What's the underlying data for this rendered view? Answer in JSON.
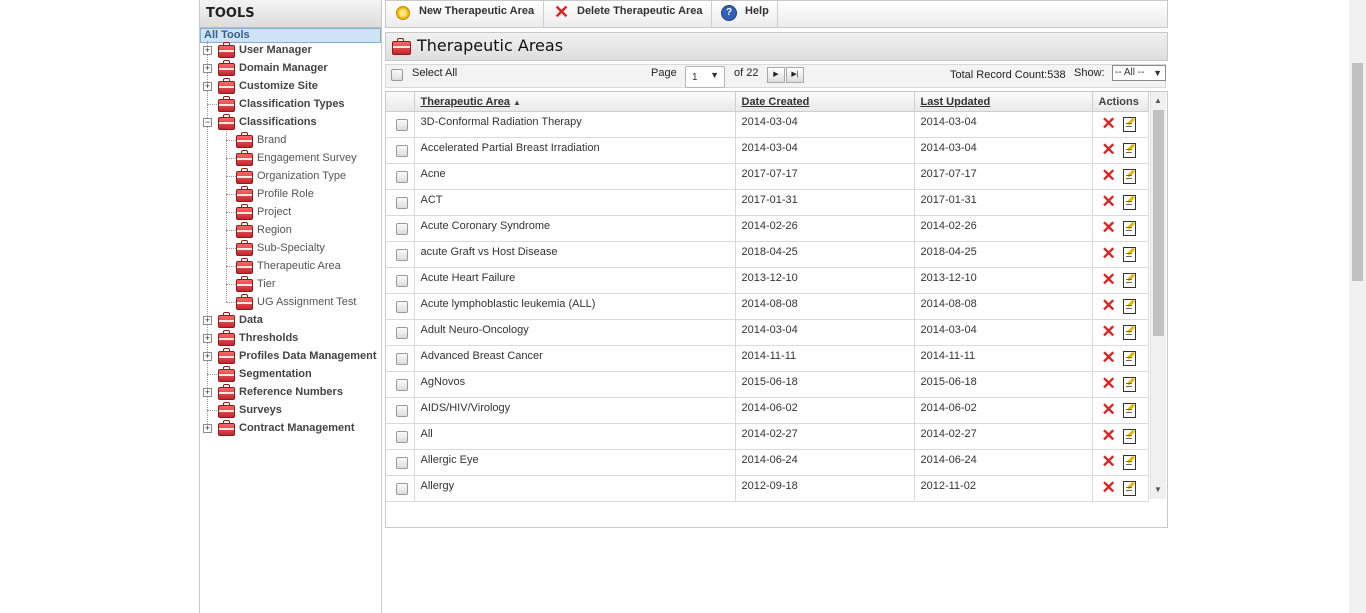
{
  "tools": {
    "title": "TOOLS",
    "all_tools": "All Tools",
    "items": [
      {
        "label": "User Manager",
        "expandable": true
      },
      {
        "label": "Domain Manager",
        "expandable": true
      },
      {
        "label": "Customize Site",
        "expandable": true
      },
      {
        "label": "Classification Types",
        "expandable": false
      },
      {
        "label": "Classifications",
        "expandable": true,
        "expanded": true
      },
      {
        "label": "Brand",
        "child": true
      },
      {
        "label": "Engagement Survey",
        "child": true
      },
      {
        "label": "Organization Type",
        "child": true
      },
      {
        "label": "Profile Role",
        "child": true
      },
      {
        "label": "Project",
        "child": true
      },
      {
        "label": "Region",
        "child": true
      },
      {
        "label": "Sub-Specialty",
        "child": true
      },
      {
        "label": "Therapeutic Area",
        "child": true
      },
      {
        "label": "Tier",
        "child": true
      },
      {
        "label": "UG Assignment Test",
        "child": true
      },
      {
        "label": "Data",
        "expandable": true
      },
      {
        "label": "Thresholds",
        "expandable": true
      },
      {
        "label": "Profiles Data Management",
        "expandable": true
      },
      {
        "label": "Segmentation",
        "expandable": false
      },
      {
        "label": "Reference Numbers",
        "expandable": true
      },
      {
        "label": "Surveys",
        "expandable": false
      },
      {
        "label": "Contract Management",
        "expandable": true
      }
    ]
  },
  "toolbar": {
    "new_label": "New Therapeutic Area",
    "delete_label": "Delete Therapeutic Area",
    "help_label": "Help",
    "help_glyph": "?"
  },
  "section": {
    "title": "Therapeutic Areas"
  },
  "pager": {
    "select_all": "Select All",
    "page_label": "Page",
    "page_value": "1",
    "of_label": "of 22",
    "record_count": "Total Record Count:538",
    "show_label": "Show:",
    "show_value": "-- All --"
  },
  "grid": {
    "columns": [
      "Therapeutic Area",
      "Date Created",
      "Last Updated",
      "Actions"
    ],
    "sort_indicator": "▲",
    "rows": [
      [
        "3D-Conformal Radiation Therapy",
        "2014-03-04",
        "2014-03-04"
      ],
      [
        "Accelerated Partial Breast Irradiation",
        "2014-03-04",
        "2014-03-04"
      ],
      [
        "Acne",
        "2017-07-17",
        "2017-07-17"
      ],
      [
        "ACT",
        "2017-01-31",
        "2017-01-31"
      ],
      [
        "Acute Coronary Syndrome",
        "2014-02-26",
        "2014-02-26"
      ],
      [
        "acute Graft vs Host Disease",
        "2018-04-25",
        "2018-04-25"
      ],
      [
        "Acute Heart Failure",
        "2013-12-10",
        "2013-12-10"
      ],
      [
        "Acute lymphoblastic leukemia (ALL)",
        "2014-08-08",
        "2014-08-08"
      ],
      [
        "Adult Neuro-Oncology",
        "2014-03-04",
        "2014-03-04"
      ],
      [
        "Advanced Breast Cancer",
        "2014-11-11",
        "2014-11-11"
      ],
      [
        "AgNovos",
        "2015-06-18",
        "2015-06-18"
      ],
      [
        "AIDS/HIV/Virology",
        "2014-06-02",
        "2014-06-02"
      ],
      [
        "All",
        "2014-02-27",
        "2014-02-27"
      ],
      [
        "Allergic Eye",
        "2014-06-24",
        "2014-06-24"
      ],
      [
        "Allergy",
        "2012-09-18",
        "2012-11-02"
      ]
    ]
  },
  "icons": {
    "new": "sun-icon",
    "delete": "x-icon",
    "help": "help-icon",
    "row_delete": "delete-icon",
    "row_edit": "edit-icon",
    "tool": "toolkit-icon"
  },
  "colors": {
    "delete_red": "#e02020",
    "selection_blue": "#cfe3f7",
    "help_blue": "#2f5fb8"
  }
}
